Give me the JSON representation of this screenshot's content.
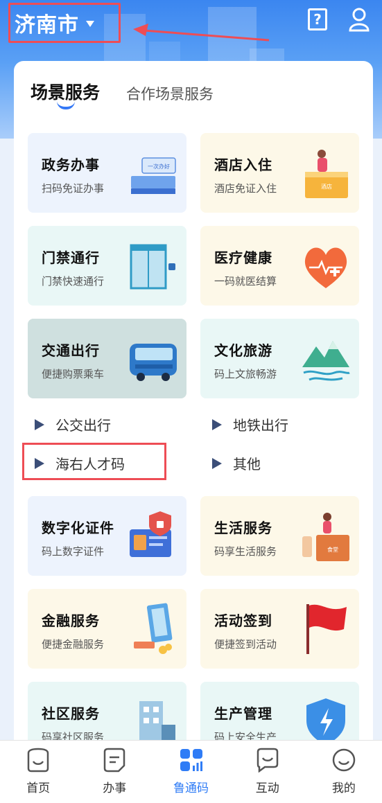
{
  "header": {
    "city": "济南市",
    "help_icon_text": "?",
    "icons": {
      "help": "help-icon",
      "user": "user-icon"
    }
  },
  "tabs": [
    {
      "label": "场景服务",
      "active": true
    },
    {
      "label": "合作场景服务",
      "active": false
    }
  ],
  "tiles": [
    {
      "title": "政务办事",
      "subtitle": "扫码免证办事",
      "icon": "government-counter-icon",
      "color": "blue"
    },
    {
      "title": "酒店入住",
      "subtitle": "酒店免证入住",
      "icon": "hotel-reception-icon",
      "color": "yellow"
    },
    {
      "title": "门禁通行",
      "subtitle": "门禁快速通行",
      "icon": "access-gate-icon",
      "color": "green"
    },
    {
      "title": "医疗健康",
      "subtitle": "一码就医结算",
      "icon": "heart-icon",
      "color": "yellow"
    },
    {
      "title": "交通出行",
      "subtitle": "便捷购票乘车",
      "icon": "bus-icon",
      "color": "grey"
    },
    {
      "title": "文化旅游",
      "subtitle": "码上文旅畅游",
      "icon": "mountain-icon",
      "color": "green"
    },
    {
      "title": "数字化证件",
      "subtitle": "码上数字证件",
      "icon": "id-card-icon",
      "color": "blue"
    },
    {
      "title": "生活服务",
      "subtitle": "码享生活服务",
      "icon": "shop-icon",
      "color": "yellow"
    },
    {
      "title": "金融服务",
      "subtitle": "便捷金融服务",
      "icon": "finance-icon",
      "color": "yellow"
    },
    {
      "title": "活动签到",
      "subtitle": "便捷签到活动",
      "icon": "flag-icon",
      "color": "yellow"
    },
    {
      "title": "社区服务",
      "subtitle": "码享社区服务",
      "icon": "community-building-icon",
      "color": "green"
    },
    {
      "title": "生产管理",
      "subtitle": "码上安全生产",
      "icon": "safety-shield-icon",
      "color": "green"
    }
  ],
  "transport_links": [
    {
      "label": "公交出行"
    },
    {
      "label": "地铁出行"
    },
    {
      "label": "海右人才码"
    },
    {
      "label": "其他"
    }
  ],
  "tile_illustration_texts": {
    "government": "一次办好",
    "hotel": "酒店",
    "shop": "食堂"
  },
  "bottom_nav": [
    {
      "label": "首页",
      "icon": "home-icon",
      "active": false
    },
    {
      "label": "办事",
      "icon": "service-icon",
      "active": false
    },
    {
      "label": "鲁通码",
      "icon": "lutong-code-icon",
      "active": true
    },
    {
      "label": "互动",
      "icon": "chat-icon",
      "active": false
    },
    {
      "label": "我的",
      "icon": "profile-icon",
      "active": false
    }
  ],
  "colors": {
    "accent": "#2f7cf6",
    "highlight": "#ee4d55",
    "header_blue": "#3b86f0"
  }
}
